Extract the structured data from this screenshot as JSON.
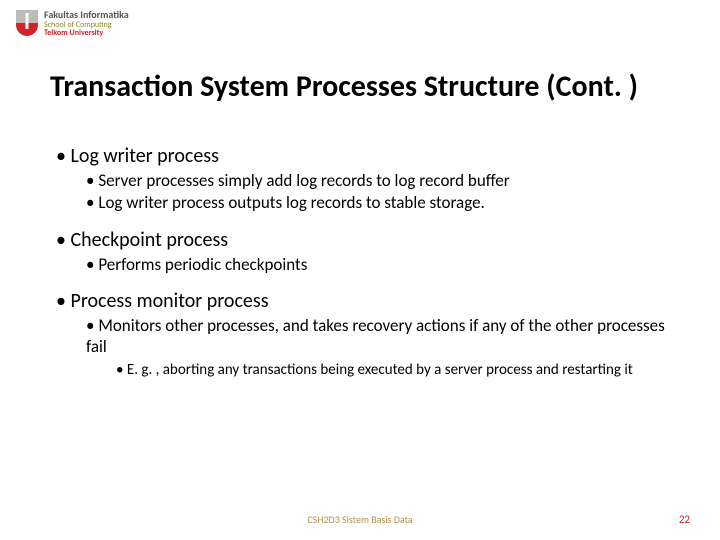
{
  "logo": {
    "line1": "Fakultas Informatika",
    "line2": "School of Computing",
    "line3": "Telkom University"
  },
  "title": "Transaction System Processes Structure (Cont. )",
  "sections": [
    {
      "heading": "Log writer process",
      "items": [
        "Server processes simply add log records to log record buffer",
        "Log writer process outputs log records to stable storage."
      ]
    },
    {
      "heading": "Checkpoint process",
      "items": [
        "Performs periodic checkpoints"
      ]
    },
    {
      "heading": "Process monitor process",
      "items": [
        "Monitors other processes, and takes recovery actions if any of the other processes fail"
      ],
      "subitems": [
        "E. g. , aborting any transactions being executed by a server process and restarting it"
      ]
    }
  ],
  "footer": "CSH2D3 Sistem Basis Data",
  "page_number": "22"
}
